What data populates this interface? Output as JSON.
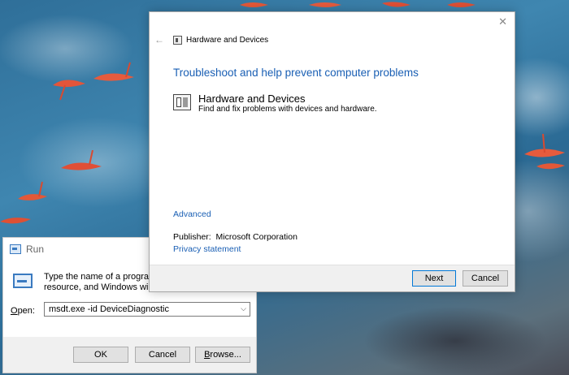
{
  "troubleshooter": {
    "header_title": "Hardware and Devices",
    "heading": "Troubleshoot and help prevent computer problems",
    "item": {
      "title": "Hardware and Devices",
      "description": "Find and fix problems with devices and hardware."
    },
    "advanced_link": "Advanced",
    "publisher_label": "Publisher:",
    "publisher_value": "Microsoft Corporation",
    "privacy_link": "Privacy statement",
    "next_button": "Next",
    "cancel_button": "Cancel",
    "close_glyph": "✕",
    "back_glyph": "←",
    "icons": [
      "hardware-devices-icon",
      "close-icon",
      "back-arrow-icon"
    ]
  },
  "run_dialog": {
    "title": "Run",
    "description_line1": "Type the name of a program, fo",
    "description_line2": "resource, and Windows will ope",
    "open_label_underlined": "O",
    "open_label_rest": "pen:",
    "input_value": "msdt.exe -id DeviceDiagnostic",
    "ok_button": "OK",
    "cancel_button": "Cancel",
    "browse_button_underlined": "B",
    "browse_button_rest": "rowse...",
    "dropdown_glyph": "⌵",
    "icons": [
      "run-icon",
      "chevron-down-icon"
    ]
  },
  "colors": {
    "accent_link": "#1a5fb4",
    "button_focus": "#0078d7",
    "dialog_footer": "#f0f0f0"
  }
}
